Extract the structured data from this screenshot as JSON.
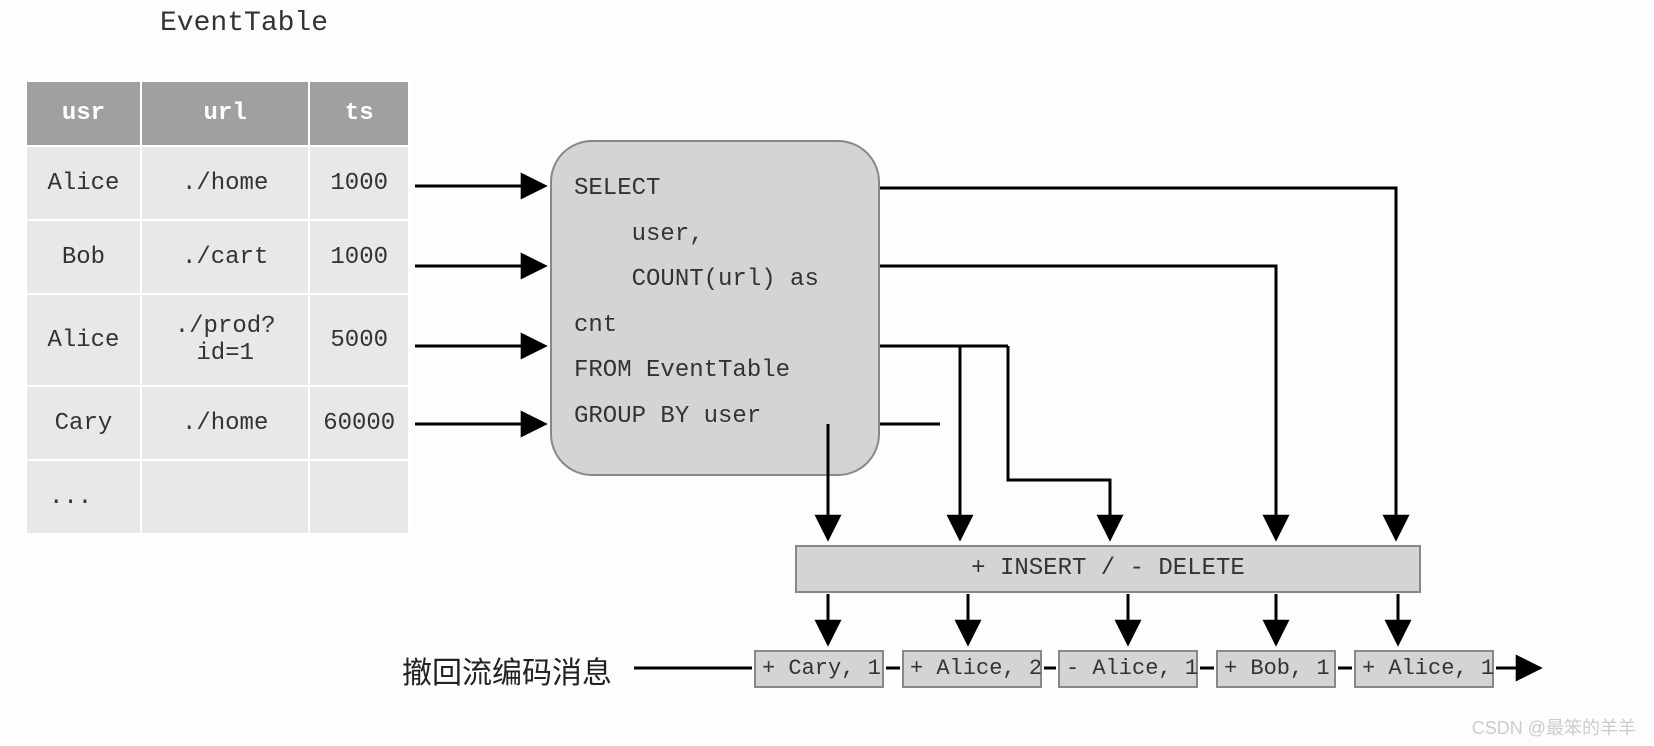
{
  "title": "EventTable",
  "table": {
    "headers": [
      "usr",
      "url",
      "ts"
    ],
    "rows": [
      {
        "usr": "Alice",
        "url": "./home",
        "ts": "1000"
      },
      {
        "usr": "Bob",
        "url": "./cart",
        "ts": "1000"
      },
      {
        "usr": "Alice",
        "url": "./prod?id=1",
        "ts": "5000"
      },
      {
        "usr": "Cary",
        "url": "./home",
        "ts": "60000"
      },
      {
        "usr": "...",
        "url": "",
        "ts": ""
      }
    ]
  },
  "sql": "SELECT\n    user,\n    COUNT(url) as\ncnt\nFROM EventTable\nGROUP BY user",
  "insdel_label": "+ INSERT / - DELETE",
  "retract_label": "撤回流编码消息",
  "messages": [
    {
      "text": "+ Cary, 1"
    },
    {
      "text": "+ Alice, 2"
    },
    {
      "text": "- Alice, 1"
    },
    {
      "text": "+ Bob, 1"
    },
    {
      "text": "+ Alice, 1"
    }
  ],
  "watermark": "CSDN @最笨的羊羊"
}
